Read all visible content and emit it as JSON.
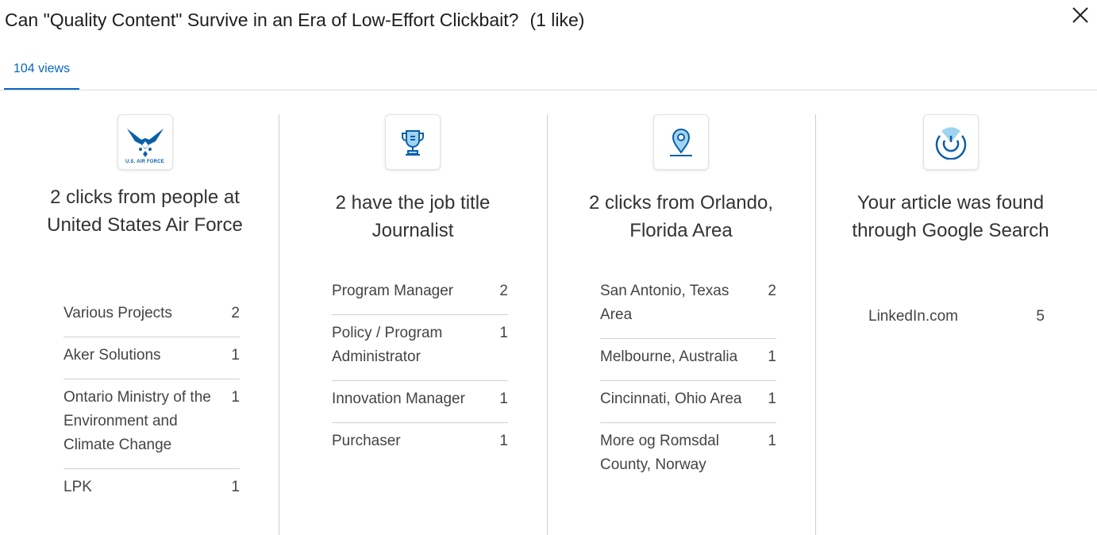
{
  "header": {
    "title": "Can \"Quality Content\" Survive in an Era of Low-Effort Clickbait?",
    "likes": "(1 like)",
    "close_icon": "close-icon"
  },
  "tabs": [
    {
      "label": "104 views",
      "active": true
    }
  ],
  "colors": {
    "accent": "#0a66c2",
    "icon_blue": "#0a5fa8",
    "icon_light_blue": "#9fd4f0"
  },
  "columns": [
    {
      "icon": "air-force-logo",
      "logo_text": "U.S. AIR FORCE",
      "headline": "2 clicks from people at United States Air Force",
      "rows": [
        {
          "label": "Various Projects",
          "count": "2"
        },
        {
          "label": "Aker Solutions",
          "count": "1"
        },
        {
          "label": "Ontario Ministry of the Environment and Climate Change",
          "count": "1"
        },
        {
          "label": "LPK",
          "count": "1"
        }
      ]
    },
    {
      "icon": "trophy-icon",
      "headline": "2 have the job title Journalist",
      "rows": [
        {
          "label": "Program Manager",
          "count": "2"
        },
        {
          "label": "Policy / Program Administrator",
          "count": "1"
        },
        {
          "label": "Innovation Manager",
          "count": "1"
        },
        {
          "label": "Purchaser",
          "count": "1"
        }
      ]
    },
    {
      "icon": "location-pin-icon",
      "headline": "2 clicks from Orlando, Florida Area",
      "rows": [
        {
          "label": "San Antonio, Texas Area",
          "count": "2"
        },
        {
          "label": "Melbourne, Australia",
          "count": "1"
        },
        {
          "label": "Cincinnati, Ohio Area",
          "count": "1"
        },
        {
          "label": "More og Romsdal County, Norway",
          "count": "1"
        }
      ]
    },
    {
      "icon": "radar-icon",
      "headline": "Your article was found through Google Search",
      "rows": [
        {
          "label": "LinkedIn.com",
          "count": "5"
        }
      ]
    }
  ]
}
